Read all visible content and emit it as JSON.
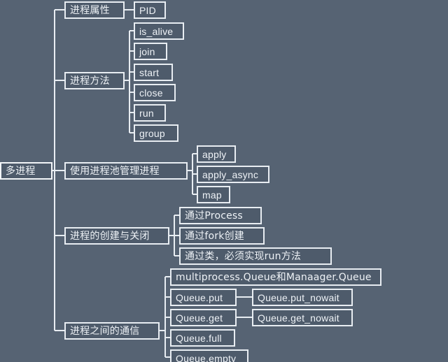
{
  "diagram": {
    "title": "多进程",
    "type": "mind-map",
    "colors": {
      "background": "#566373",
      "node_fill": "#4e5b6b",
      "node_border": "#e8edf2",
      "text": "#eef2f6",
      "connector": "#e8edf2"
    },
    "root": {
      "label": "多进程"
    },
    "branches": [
      {
        "label": "进程属性",
        "children": [
          {
            "label": "PID"
          }
        ]
      },
      {
        "label": "进程方法",
        "children": [
          {
            "label": "is_alive"
          },
          {
            "label": "join"
          },
          {
            "label": "start"
          },
          {
            "label": "close"
          },
          {
            "label": "run"
          },
          {
            "label": "group"
          }
        ]
      },
      {
        "label": "使用进程池管理进程",
        "children": [
          {
            "label": "apply"
          },
          {
            "label": "apply_async"
          },
          {
            "label": "map"
          }
        ]
      },
      {
        "label": "进程的创建与关闭",
        "children": [
          {
            "label": "通过Process"
          },
          {
            "label": "通过fork创建"
          },
          {
            "label": "通过类，必须实现run方法"
          }
        ]
      },
      {
        "label": "进程之间的通信",
        "children": [
          {
            "label": "multiprocess.Queue和Manaager.Queue"
          },
          {
            "label": "Queue.put",
            "children": [
              {
                "label": "Queue.put_nowait"
              }
            ]
          },
          {
            "label": "Queue.get",
            "children": [
              {
                "label": "Queue.get_nowait"
              }
            ]
          },
          {
            "label": "Queue.full"
          },
          {
            "label": "Queue.empty"
          }
        ]
      }
    ]
  }
}
